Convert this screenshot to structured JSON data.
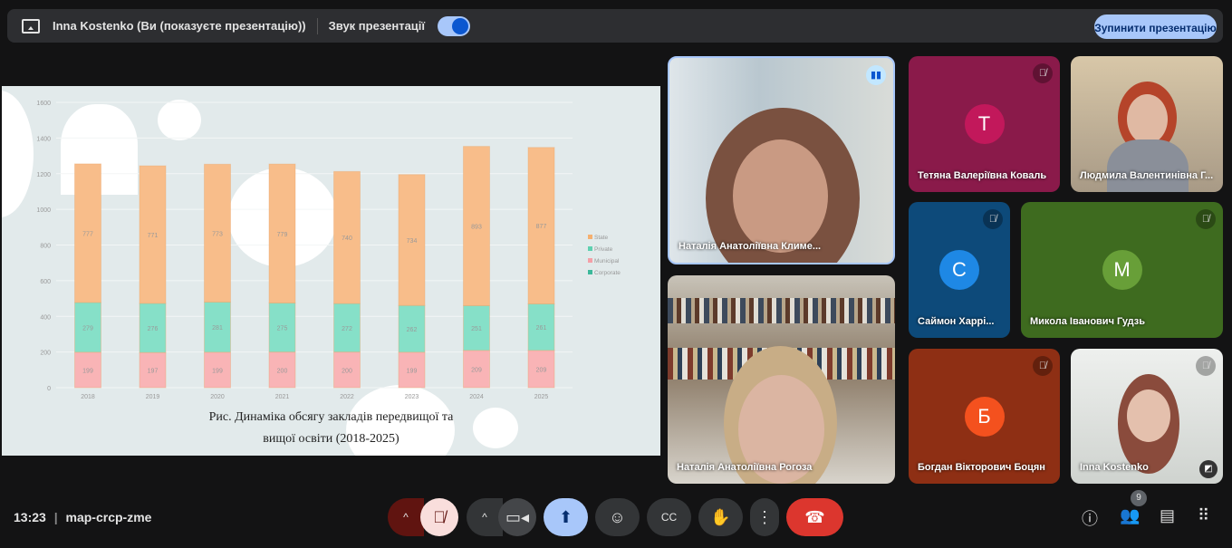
{
  "topbar": {
    "presenter": "Inna Kostenko (Ви (показуєте презентацію))",
    "sound_label": "Звук презентації",
    "stop_button": "Зупинити презентацію"
  },
  "slide": {
    "caption_line1": "Рис. Динаміка обсягу закладів передвищої та",
    "caption_line2": "вищої освіти (2018-2025)"
  },
  "chart_data": {
    "type": "bar",
    "stacked": true,
    "categories": [
      "2018",
      "2019",
      "2020",
      "2021",
      "2022",
      "2023",
      "2024",
      "2025"
    ],
    "series": [
      {
        "name": "Municipal",
        "color": "#f9b4b6",
        "values": [
          199,
          197,
          199,
          200,
          200,
          199,
          209,
          209
        ]
      },
      {
        "name": "Private",
        "color": "#86e0c8",
        "values": [
          279,
          276,
          281,
          275,
          272,
          262,
          251,
          261
        ]
      },
      {
        "name": "State",
        "color": "#f8bd8a",
        "values": [
          777,
          771,
          773,
          779,
          740,
          734,
          893,
          877
        ]
      }
    ],
    "legend": [
      {
        "name": "State",
        "color": "#f5b070"
      },
      {
        "name": "Private",
        "color": "#5fd0b0"
      },
      {
        "name": "Municipal",
        "color": "#f4a0a8"
      },
      {
        "name": "Corporate",
        "color": "#3cb89a"
      }
    ],
    "legend_position": "right",
    "ylim": [
      0,
      1600
    ],
    "yticks": [
      0,
      200,
      400,
      600,
      800,
      1000,
      1200,
      1400,
      1600
    ],
    "grid": true
  },
  "participants": [
    {
      "name": "Наталія Анатоліївна Климе...",
      "pinned": true,
      "speaking": true
    },
    {
      "name": "Наталія Анатоліївна Рогоза",
      "pinned": true
    },
    {
      "name": "Тетяна Валеріївна Коваль",
      "initial": "Т",
      "color": "#c2185b",
      "muted": true
    },
    {
      "name": "Людмила Валентинівна Г..."
    },
    {
      "name": "Саймон Харрі...",
      "initial": "С",
      "color": "#1e88e5",
      "muted": true
    },
    {
      "name": "Микола Іванович Гудзь",
      "initial": "М",
      "color": "#689f38",
      "muted": true
    },
    {
      "name": "Богдан Вікторович Боцян",
      "initial": "Б",
      "color": "#f4511e",
      "muted": true
    },
    {
      "name": "Inna Kostenko",
      "muted": true
    }
  ],
  "bottom": {
    "time": "13:23",
    "separator": "|",
    "meeting_code": "map-crcp-zme",
    "participants_count": "9"
  }
}
